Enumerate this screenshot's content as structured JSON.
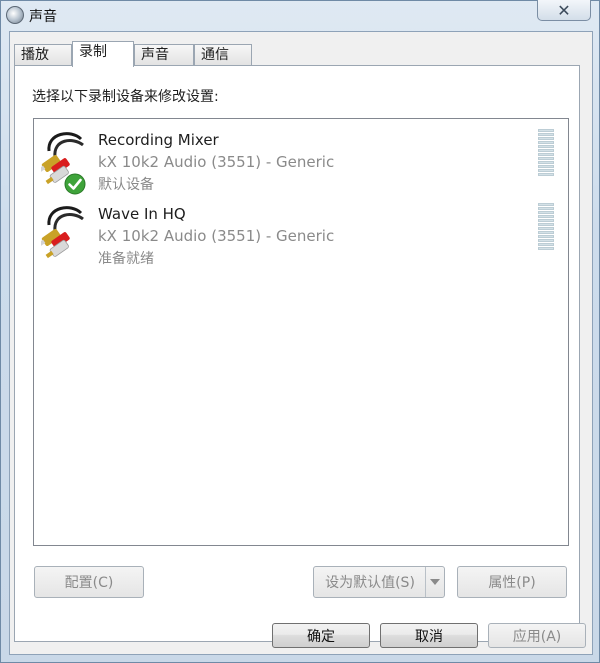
{
  "window": {
    "title": "声音",
    "close_glyph": "✕"
  },
  "tabs": [
    {
      "label": "播放",
      "active": false
    },
    {
      "label": "录制",
      "active": true
    },
    {
      "label": "声音",
      "active": false
    },
    {
      "label": "通信",
      "active": false
    }
  ],
  "recording": {
    "instruction": "选择以下录制设备来修改设置:",
    "devices": [
      {
        "name": "Recording Mixer",
        "driver": "kX 10k2 Audio (3551) - Generic",
        "status": "默认设备",
        "is_default": true,
        "icon": "rca-cable-icon"
      },
      {
        "name": "Wave In HQ",
        "driver": "kX 10k2 Audio (3551) - Generic",
        "status": "准备就绪",
        "is_default": false,
        "icon": "rca-cable-icon"
      }
    ]
  },
  "actions": {
    "configure": "配置(C)",
    "set_default": "设为默认值(S)",
    "properties": "属性(P)"
  },
  "footer": {
    "ok": "确定",
    "cancel": "取消",
    "apply": "应用(A)"
  },
  "colors": {
    "window_frame": "#cddcec",
    "panel": "#ffffff",
    "default_check": "#3ea33a",
    "meter_segment": "#d4e1e7"
  }
}
